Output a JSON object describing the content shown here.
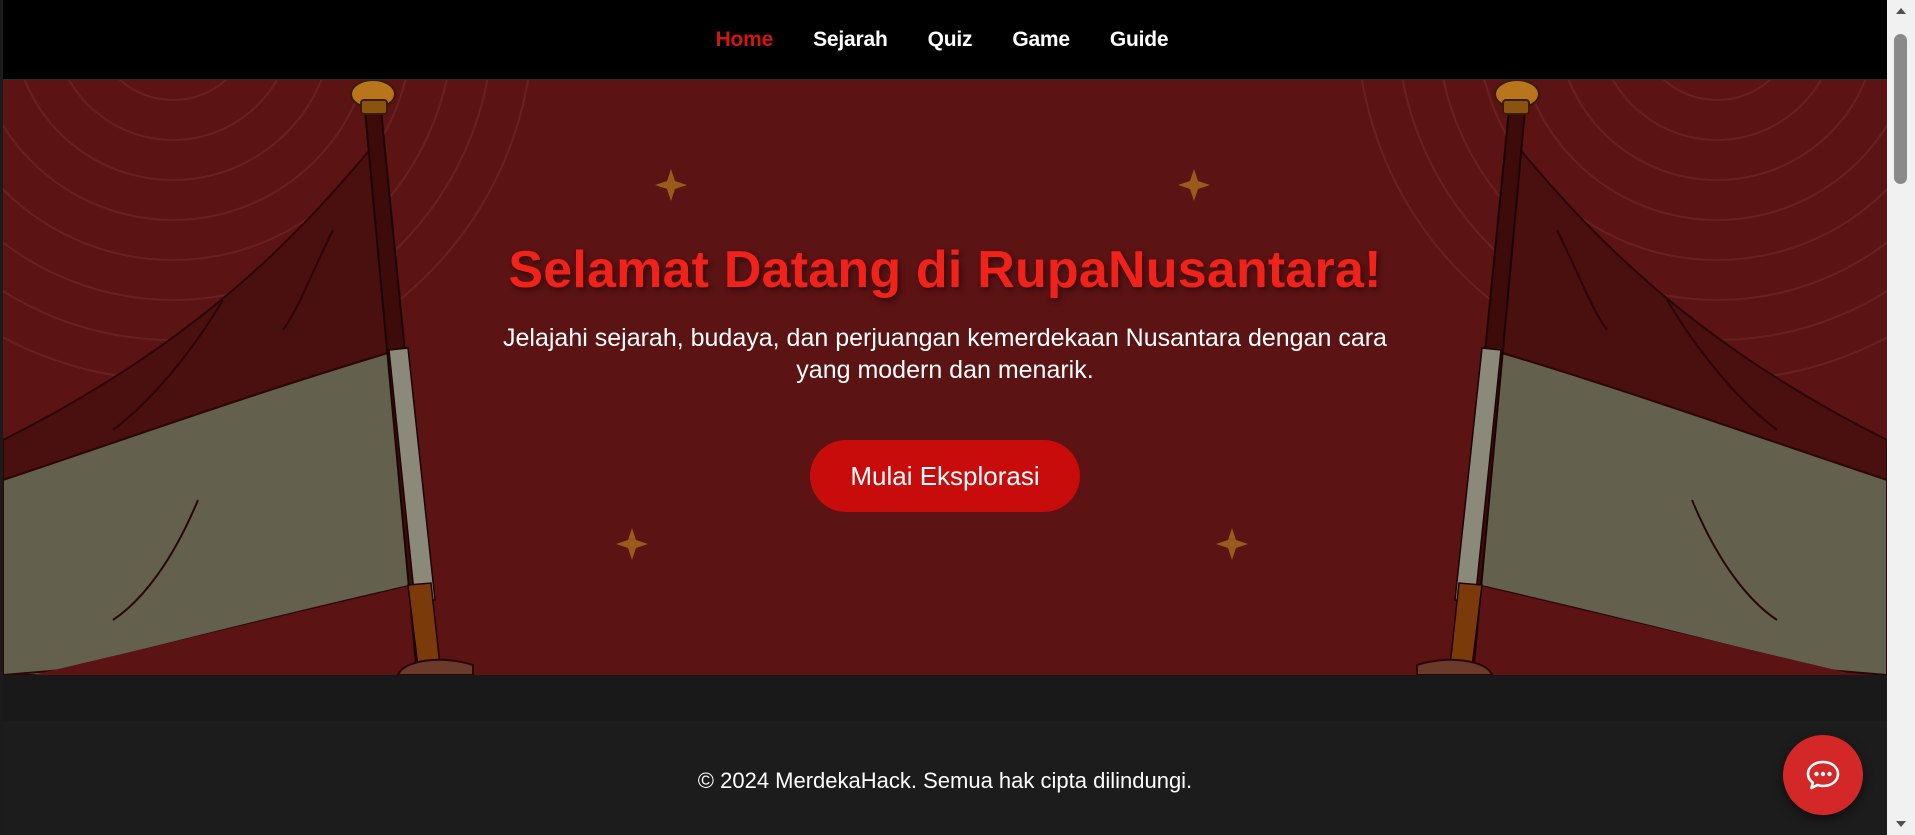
{
  "nav": {
    "items": [
      {
        "label": "Home",
        "active": true
      },
      {
        "label": "Sejarah",
        "active": false
      },
      {
        "label": "Quiz",
        "active": false
      },
      {
        "label": "Game",
        "active": false
      },
      {
        "label": "Guide",
        "active": false
      }
    ]
  },
  "hero": {
    "title": "Selamat Datang di RupaNusantara!",
    "subtitle": "Jelajahi sejarah, budaya, dan perjuangan kemerdekaan Nusantara dengan cara yang modern dan menarik.",
    "cta_label": "Mulai Eksplorasi",
    "decor": [
      "flag-left",
      "flag-right",
      "sparkle-icon",
      "sparkle-icon",
      "sparkle-icon",
      "sparkle-icon"
    ]
  },
  "footer": {
    "copyright": "© 2024 MerdekaHack. Semua hak cipta dilindungi."
  },
  "chat": {
    "icon": "chat-bubble-icon"
  },
  "colors": {
    "nav_bg": "#000000",
    "nav_active": "#d01616",
    "hero_bg": "#5b1314",
    "title": "#f0221a",
    "cta_bg": "#c80b0b",
    "footer_bg": "#1c1c1c",
    "chat_bg": "#d42828",
    "gold": "#b8751c"
  }
}
